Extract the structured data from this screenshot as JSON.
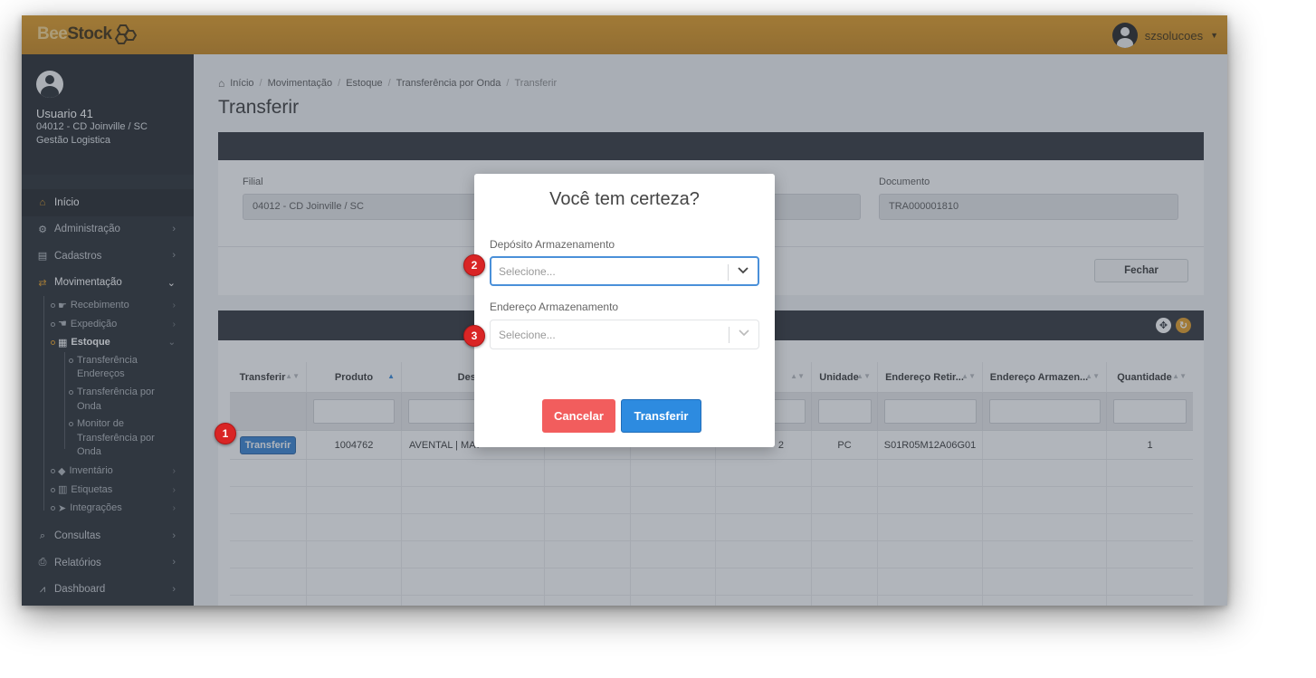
{
  "header": {
    "logo_bee": "Bee",
    "logo_stock": "Stock",
    "username": "szsolucoes"
  },
  "sidebar": {
    "user_name": "Usuario 41",
    "user_branch": "04012 - CD Joinville / SC",
    "user_role": "Gestão Logistica",
    "items": [
      {
        "label": "Início",
        "icon": "home-icon"
      },
      {
        "label": "Administração",
        "icon": "gears-icon"
      },
      {
        "label": "Cadastros",
        "icon": "list-icon"
      },
      {
        "label": "Movimentação",
        "icon": "exchange-icon"
      },
      {
        "label": "Consultas",
        "icon": "search-icon"
      },
      {
        "label": "Relatórios",
        "icon": "print-icon"
      },
      {
        "label": "Dashboard",
        "icon": "chart-icon"
      }
    ],
    "mov_sub": [
      {
        "label": "Recebimento",
        "icon": "hand-right-icon"
      },
      {
        "label": "Expedição",
        "icon": "hand-left-icon"
      },
      {
        "label": "Estoque",
        "icon": "grid-icon"
      },
      {
        "label": "Inventário",
        "icon": "tags-icon"
      },
      {
        "label": "Etiquetas",
        "icon": "barcode-icon"
      },
      {
        "label": "Integrações",
        "icon": "plane-icon"
      }
    ],
    "estoque_sub": [
      "Transferência Endereços",
      "Transferência por Onda",
      "Monitor de Transferência por Onda"
    ]
  },
  "breadcrumb": [
    "Início",
    "Movimentação",
    "Estoque",
    "Transferência por Onda",
    "Transferir"
  ],
  "page_title": "Transferir",
  "form": {
    "filial_label": "Filial",
    "filial_value": "04012 - CD Joinville / SC",
    "documento_label": "Documento",
    "documento_value": "TRA000001810",
    "close_label": "Fechar"
  },
  "table": {
    "columns": [
      "Transferir",
      "Produto",
      "Descri",
      "",
      "",
      "",
      "Unidade",
      "Endereço Retir...",
      "Endereço Armazen...",
      "Quantidade"
    ],
    "row": {
      "action": "Transferir",
      "produto": "1004762",
      "descricao": "AVENTAL | MAT",
      "col_obscured": "2",
      "unidade": "PC",
      "end_retirada": "S01R05M12A06G01",
      "end_armazen": "",
      "quantidade": "1"
    }
  },
  "modal": {
    "title": "Você tem certeza?",
    "deposito_label": "Depósito Armazenamento",
    "deposito_placeholder": "Selecione...",
    "endereco_label": "Endereço Armazenamento",
    "endereco_placeholder": "Selecione...",
    "cancel_label": "Cancelar",
    "transfer_label": "Transferir"
  },
  "markers": [
    "1",
    "2",
    "3"
  ],
  "colors": {
    "accent": "#e39a1c",
    "primary": "#2d8be0",
    "danger": "#f25d5d",
    "marker": "#d92525"
  }
}
